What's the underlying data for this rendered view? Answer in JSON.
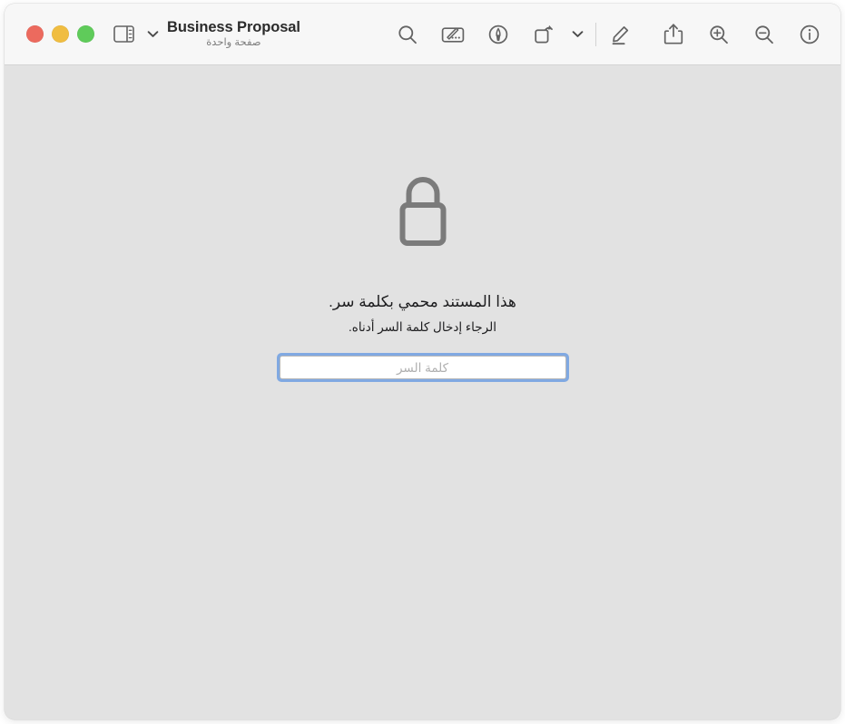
{
  "window": {
    "traffic_lights": [
      {
        "name": "zoom-button",
        "color": "#5fcb5a"
      },
      {
        "name": "minimize-button",
        "color": "#f0bd41"
      },
      {
        "name": "close-button",
        "color": "#ec6a5e"
      }
    ]
  },
  "toolbar": {
    "title": "Business Proposal",
    "subtitle": "صفحة واحدة",
    "buttons": [
      {
        "id": "search",
        "icon": "search-icon",
        "label": "بحث"
      },
      {
        "id": "markup",
        "icon": "markup-toolbar-icon",
        "label": "أدوات التوصيف"
      },
      {
        "id": "sign",
        "icon": "pen-nib-circle-icon",
        "label": "توقيع"
      },
      {
        "id": "rotate",
        "icon": "rotate-icon",
        "label": "تدوير"
      },
      {
        "id": "more",
        "icon": "chevron-down-icon",
        "label": "المزيد"
      },
      {
        "id": "highlight",
        "icon": "pencil-underline-icon",
        "label": "تحديد"
      },
      {
        "id": "share",
        "icon": "share-icon",
        "label": "مشاركة"
      },
      {
        "id": "zoom-in",
        "icon": "zoom-in-icon",
        "label": "تكبير"
      },
      {
        "id": "zoom-out",
        "icon": "zoom-out-icon",
        "label": "تصغير"
      },
      {
        "id": "info",
        "icon": "info-icon",
        "label": "معلومات"
      },
      {
        "id": "title-menu",
        "icon": "chevron-down-icon",
        "label": "قائمة المستند"
      },
      {
        "id": "sidebar-toggle",
        "icon": "sidebar-icon",
        "label": "إظهار الشريط الجانبي"
      }
    ]
  },
  "main": {
    "lock_icon": "lock-icon",
    "message_primary": "هذا المستند محمي بكلمة سر.",
    "message_secondary": "الرجاء إدخال كلمة السر أدناه.",
    "password_field": {
      "value": "",
      "placeholder": "كلمة السر"
    }
  },
  "colors": {
    "toolbar_bg": "#f7f7f7",
    "content_bg": "#e2e2e2",
    "icon_stroke": "#636363",
    "focus_ring": "#80a9e2",
    "title_text": "#2b2b2b",
    "subtitle_text": "#7d7d7d"
  }
}
